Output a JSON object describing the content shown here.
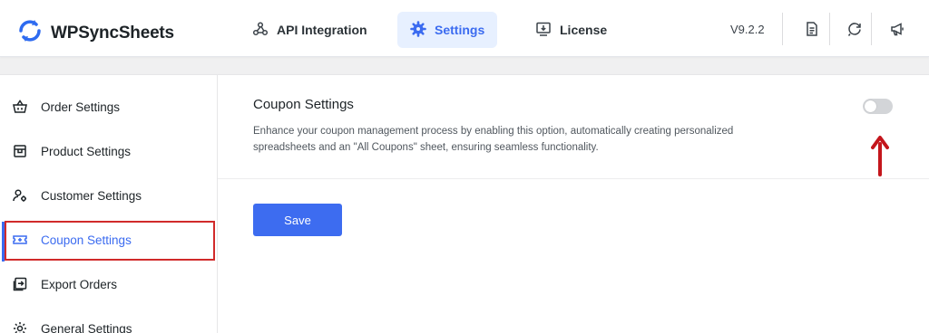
{
  "header": {
    "logo_text": "WPSyncSheets",
    "nav": {
      "api": "API Integration",
      "settings": "Settings",
      "license": "License"
    },
    "version": "V9.2.2",
    "icons": [
      "document-icon",
      "refresh-chat-icon",
      "megaphone-icon"
    ]
  },
  "sidebar": {
    "items": [
      {
        "label": "Order Settings",
        "icon": "basket-icon"
      },
      {
        "label": "Product Settings",
        "icon": "product-box-icon"
      },
      {
        "label": "Customer Settings",
        "icon": "users-gear-icon"
      },
      {
        "label": "Coupon Settings",
        "icon": "coupon-icon"
      },
      {
        "label": "Export Orders",
        "icon": "export-icon"
      },
      {
        "label": "General Settings",
        "icon": "gear-icon"
      }
    ],
    "active_index": 3
  },
  "main": {
    "title": "Coupon Settings",
    "description": "Enhance your coupon management process by enabling this option, automatically creating personalized spreadsheets and an \"All Coupons\" sheet, ensuring seamless functionality.",
    "toggle_enabled": false,
    "save_label": "Save"
  },
  "colors": {
    "accent": "#3b6bf0",
    "annotation_red": "#d12a2a",
    "toggle_off": "#d3d5d8"
  }
}
